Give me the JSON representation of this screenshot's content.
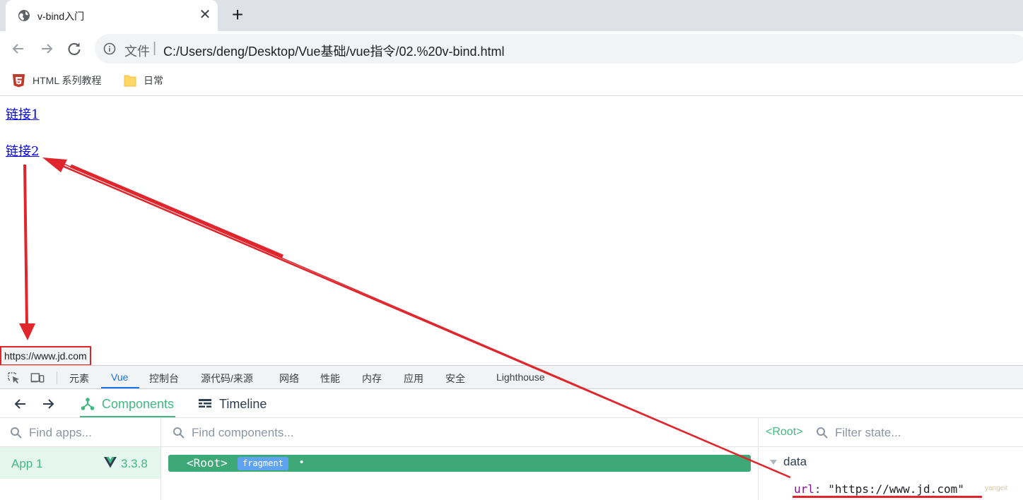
{
  "browser": {
    "tab": {
      "title": "v-bind入门",
      "close_glyph": "✕",
      "favicon": "globe-icon"
    },
    "new_tab_glyph": "+",
    "address": {
      "scheme_label": "文件",
      "separator": "|",
      "url": "C:/Users/deng/Desktop/Vue基础/vue指令/02.%20v-bind.html"
    },
    "bookmarks": [
      {
        "label": "HTML 系列教程",
        "icon": "html5-icon",
        "color": "#e34f26"
      },
      {
        "label": "日常",
        "icon": "folder-icon",
        "color": "#fdd663"
      }
    ]
  },
  "page": {
    "links": [
      "链接1",
      "链接2"
    ],
    "status_url": "https://www.jd.com"
  },
  "devtools": {
    "tabs": [
      "元素",
      "Vue",
      "控制台",
      "源代码/来源",
      "网络",
      "性能",
      "内存",
      "应用",
      "安全",
      "Lighthouse"
    ],
    "active_tab": "Vue",
    "accent": "#1a73e8"
  },
  "vue_devtools": {
    "nav": {
      "components": "Components",
      "timeline": "Timeline"
    },
    "apps_search_placeholder": "Find apps...",
    "components_search_placeholder": "Find components...",
    "state_search_placeholder": "Filter state...",
    "app": {
      "name": "App 1",
      "version": "3.3.8"
    },
    "root_node": {
      "tag": "<Root>",
      "badge": "fragment",
      "dot": "•"
    },
    "state": {
      "selected": "<Root>",
      "section": "data",
      "key": "url",
      "colon": ":",
      "value": "\"https://www.jd.com\"",
      "watermark": "yangeit"
    },
    "brand_color": "#42b883"
  },
  "annotation": {
    "color": "#e0262c"
  }
}
